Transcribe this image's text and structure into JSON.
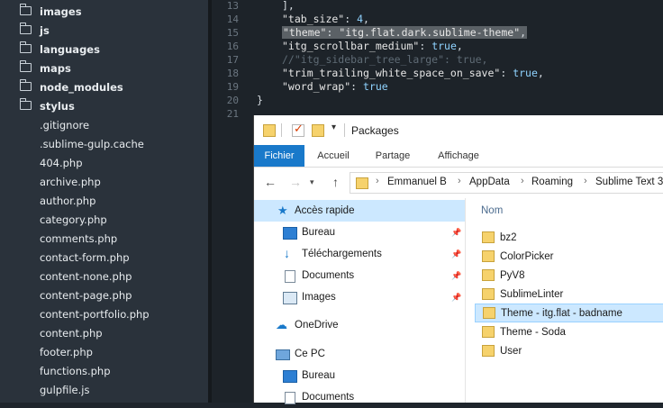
{
  "sidebar": {
    "folders": [
      "images",
      "js",
      "languages",
      "maps",
      "node_modules",
      "stylus"
    ],
    "files": [
      ".gitignore",
      ".sublime-gulp.cache",
      "404.php",
      "archive.php",
      "author.php",
      "category.php",
      "comments.php",
      "contact-form.php",
      "content-none.php",
      "content-page.php",
      "content-portfolio.php",
      "content.php",
      "footer.php",
      "functions.php",
      "gulpfile.js"
    ]
  },
  "editor": {
    "line_numbers": [
      "13",
      "14",
      "15",
      "16",
      "17",
      "18",
      "19",
      "20",
      "21"
    ],
    "lines": [
      {
        "text": "],"
      },
      {
        "key": "\"tab_size\"",
        "sep": ": ",
        "val": "4",
        "end": ","
      },
      {
        "key": "\"theme\"",
        "sep": ": ",
        "val": "\"itg.flat.dark.sublime-theme\"",
        "end": ","
      },
      {
        "key": "\"itg_scrollbar_medium\"",
        "sep": ": ",
        "val": "true",
        "end": ","
      },
      {
        "comment": "//\"itg_sidebar_tree_large\": true,"
      },
      {
        "key": "\"trim_trailing_white_space_on_save\"",
        "sep": ": ",
        "val": "true",
        "end": ","
      },
      {
        "key": "\"word_wrap\"",
        "sep": ": ",
        "val": "true",
        "end": ""
      },
      {
        "text": "}"
      },
      {
        "text": ""
      }
    ]
  },
  "explorer": {
    "title": "Packages",
    "ribbon_tabs": [
      "Fichier",
      "Accueil",
      "Partage",
      "Affichage"
    ],
    "breadcrumb": [
      "Emmanuel B",
      "AppData",
      "Roaming",
      "Sublime Text 3"
    ],
    "nav": {
      "quick_access": "Accès rapide",
      "bureau": "Bureau",
      "telechargements": "Téléchargements",
      "documents": "Documents",
      "images": "Images",
      "onedrive": "OneDrive",
      "ce_pc": "Ce PC",
      "bureau2": "Bureau",
      "documents2": "Documents"
    },
    "column_header": "Nom",
    "folders": [
      "bz2",
      "ColorPicker",
      "PyV8",
      "SublimeLinter",
      "Theme - itg.flat - badname",
      "Theme - Soda",
      "User"
    ]
  },
  "colors": {
    "accent": "#1979ca",
    "selection": "#cce8ff",
    "sidebar_bg": "#2a323b",
    "editor_bg": "#1d2329"
  }
}
